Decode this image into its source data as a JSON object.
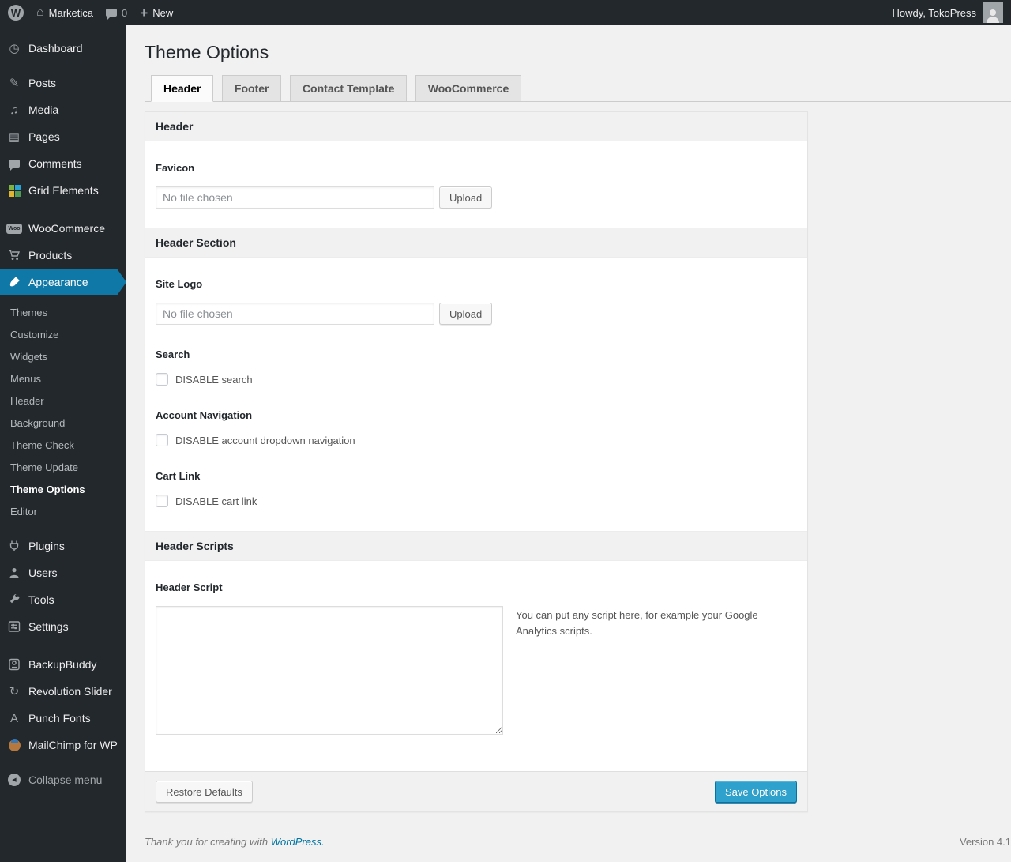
{
  "admin_bar": {
    "site_name": "Marketica",
    "comment_count": "0",
    "new_label": "New",
    "howdy": "Howdy, TokoPress"
  },
  "sidebar": {
    "items": [
      {
        "label": "Dashboard"
      },
      {
        "label": "Posts"
      },
      {
        "label": "Media"
      },
      {
        "label": "Pages"
      },
      {
        "label": "Comments"
      },
      {
        "label": "Grid Elements"
      },
      {
        "label": "WooCommerce"
      },
      {
        "label": "Products"
      },
      {
        "label": "Appearance"
      },
      {
        "label": "Plugins"
      },
      {
        "label": "Users"
      },
      {
        "label": "Tools"
      },
      {
        "label": "Settings"
      },
      {
        "label": "BackupBuddy"
      },
      {
        "label": "Revolution Slider"
      },
      {
        "label": "Punch Fonts"
      },
      {
        "label": "MailChimp for WP"
      },
      {
        "label": "Collapse menu"
      }
    ],
    "woo_badge": "Woo",
    "appearance_submenu": [
      "Themes",
      "Customize",
      "Widgets",
      "Menus",
      "Header",
      "Background",
      "Theme Check",
      "Theme Update",
      "Theme Options",
      "Editor"
    ],
    "active_item": "Appearance",
    "active_submenu_item": "Theme Options"
  },
  "page": {
    "title": "Theme Options",
    "tabs": [
      "Header",
      "Footer",
      "Contact Template",
      "WooCommerce"
    ],
    "active_tab": "Header"
  },
  "panel": {
    "sections": [
      {
        "title": "Header"
      },
      {
        "title": "Header Section"
      },
      {
        "title": "Header Scripts"
      }
    ],
    "favicon": {
      "label": "Favicon",
      "file_value": "No file chosen",
      "upload_label": "Upload"
    },
    "site_logo": {
      "label": "Site Logo",
      "file_value": "No file chosen",
      "upload_label": "Upload"
    },
    "search": {
      "label": "Search",
      "checkbox_label": "DISABLE search",
      "checked": false
    },
    "account_nav": {
      "label": "Account Navigation",
      "checkbox_label": "DISABLE account dropdown navigation",
      "checked": false
    },
    "cart_link": {
      "label": "Cart Link",
      "checkbox_label": "DISABLE cart link",
      "checked": false
    },
    "header_script": {
      "label": "Header Script",
      "value": "",
      "help": "You can put any script here, for example your Google Analytics scripts."
    },
    "footer": {
      "restore_label": "Restore Defaults",
      "save_label": "Save Options"
    }
  },
  "page_footer": {
    "thanks_text": "Thank you for creating with ",
    "thanks_link": "WordPress.",
    "version": "Version 4.1"
  },
  "colors": {
    "accent_blue": "#0f78a6",
    "button_primary": "#2ea2cc",
    "admin_dark": "#23282d",
    "page_bg": "#f1f1f1"
  }
}
